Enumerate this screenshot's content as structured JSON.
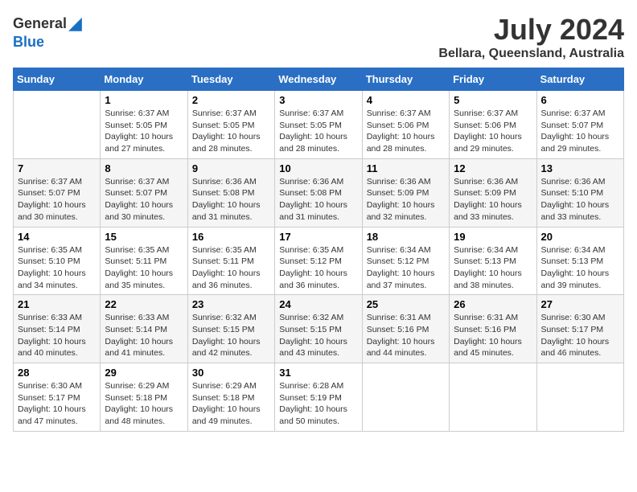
{
  "header": {
    "logo_general": "General",
    "logo_blue": "Blue",
    "month_year": "July 2024",
    "location": "Bellara, Queensland, Australia"
  },
  "columns": [
    "Sunday",
    "Monday",
    "Tuesday",
    "Wednesday",
    "Thursday",
    "Friday",
    "Saturday"
  ],
  "weeks": [
    [
      {
        "day": "",
        "info": ""
      },
      {
        "day": "1",
        "info": "Sunrise: 6:37 AM\nSunset: 5:05 PM\nDaylight: 10 hours\nand 27 minutes."
      },
      {
        "day": "2",
        "info": "Sunrise: 6:37 AM\nSunset: 5:05 PM\nDaylight: 10 hours\nand 28 minutes."
      },
      {
        "day": "3",
        "info": "Sunrise: 6:37 AM\nSunset: 5:05 PM\nDaylight: 10 hours\nand 28 minutes."
      },
      {
        "day": "4",
        "info": "Sunrise: 6:37 AM\nSunset: 5:06 PM\nDaylight: 10 hours\nand 28 minutes."
      },
      {
        "day": "5",
        "info": "Sunrise: 6:37 AM\nSunset: 5:06 PM\nDaylight: 10 hours\nand 29 minutes."
      },
      {
        "day": "6",
        "info": "Sunrise: 6:37 AM\nSunset: 5:07 PM\nDaylight: 10 hours\nand 29 minutes."
      }
    ],
    [
      {
        "day": "7",
        "info": "Sunrise: 6:37 AM\nSunset: 5:07 PM\nDaylight: 10 hours\nand 30 minutes."
      },
      {
        "day": "8",
        "info": "Sunrise: 6:37 AM\nSunset: 5:07 PM\nDaylight: 10 hours\nand 30 minutes."
      },
      {
        "day": "9",
        "info": "Sunrise: 6:36 AM\nSunset: 5:08 PM\nDaylight: 10 hours\nand 31 minutes."
      },
      {
        "day": "10",
        "info": "Sunrise: 6:36 AM\nSunset: 5:08 PM\nDaylight: 10 hours\nand 31 minutes."
      },
      {
        "day": "11",
        "info": "Sunrise: 6:36 AM\nSunset: 5:09 PM\nDaylight: 10 hours\nand 32 minutes."
      },
      {
        "day": "12",
        "info": "Sunrise: 6:36 AM\nSunset: 5:09 PM\nDaylight: 10 hours\nand 33 minutes."
      },
      {
        "day": "13",
        "info": "Sunrise: 6:36 AM\nSunset: 5:10 PM\nDaylight: 10 hours\nand 33 minutes."
      }
    ],
    [
      {
        "day": "14",
        "info": "Sunrise: 6:35 AM\nSunset: 5:10 PM\nDaylight: 10 hours\nand 34 minutes."
      },
      {
        "day": "15",
        "info": "Sunrise: 6:35 AM\nSunset: 5:11 PM\nDaylight: 10 hours\nand 35 minutes."
      },
      {
        "day": "16",
        "info": "Sunrise: 6:35 AM\nSunset: 5:11 PM\nDaylight: 10 hours\nand 36 minutes."
      },
      {
        "day": "17",
        "info": "Sunrise: 6:35 AM\nSunset: 5:12 PM\nDaylight: 10 hours\nand 36 minutes."
      },
      {
        "day": "18",
        "info": "Sunrise: 6:34 AM\nSunset: 5:12 PM\nDaylight: 10 hours\nand 37 minutes."
      },
      {
        "day": "19",
        "info": "Sunrise: 6:34 AM\nSunset: 5:13 PM\nDaylight: 10 hours\nand 38 minutes."
      },
      {
        "day": "20",
        "info": "Sunrise: 6:34 AM\nSunset: 5:13 PM\nDaylight: 10 hours\nand 39 minutes."
      }
    ],
    [
      {
        "day": "21",
        "info": "Sunrise: 6:33 AM\nSunset: 5:14 PM\nDaylight: 10 hours\nand 40 minutes."
      },
      {
        "day": "22",
        "info": "Sunrise: 6:33 AM\nSunset: 5:14 PM\nDaylight: 10 hours\nand 41 minutes."
      },
      {
        "day": "23",
        "info": "Sunrise: 6:32 AM\nSunset: 5:15 PM\nDaylight: 10 hours\nand 42 minutes."
      },
      {
        "day": "24",
        "info": "Sunrise: 6:32 AM\nSunset: 5:15 PM\nDaylight: 10 hours\nand 43 minutes."
      },
      {
        "day": "25",
        "info": "Sunrise: 6:31 AM\nSunset: 5:16 PM\nDaylight: 10 hours\nand 44 minutes."
      },
      {
        "day": "26",
        "info": "Sunrise: 6:31 AM\nSunset: 5:16 PM\nDaylight: 10 hours\nand 45 minutes."
      },
      {
        "day": "27",
        "info": "Sunrise: 6:30 AM\nSunset: 5:17 PM\nDaylight: 10 hours\nand 46 minutes."
      }
    ],
    [
      {
        "day": "28",
        "info": "Sunrise: 6:30 AM\nSunset: 5:17 PM\nDaylight: 10 hours\nand 47 minutes."
      },
      {
        "day": "29",
        "info": "Sunrise: 6:29 AM\nSunset: 5:18 PM\nDaylight: 10 hours\nand 48 minutes."
      },
      {
        "day": "30",
        "info": "Sunrise: 6:29 AM\nSunset: 5:18 PM\nDaylight: 10 hours\nand 49 minutes."
      },
      {
        "day": "31",
        "info": "Sunrise: 6:28 AM\nSunset: 5:19 PM\nDaylight: 10 hours\nand 50 minutes."
      },
      {
        "day": "",
        "info": ""
      },
      {
        "day": "",
        "info": ""
      },
      {
        "day": "",
        "info": ""
      }
    ]
  ]
}
